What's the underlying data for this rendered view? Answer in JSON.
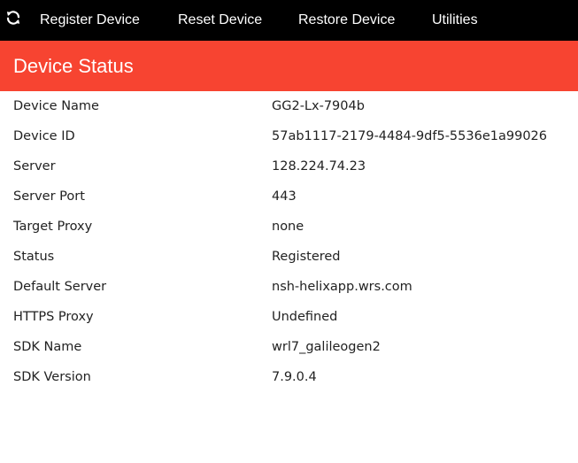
{
  "nav": {
    "refresh_icon": "refresh-icon",
    "items": [
      {
        "label": "Register Device"
      },
      {
        "label": "Reset Device"
      },
      {
        "label": "Restore Device"
      },
      {
        "label": "Utilities"
      }
    ]
  },
  "header": {
    "title": "Device Status",
    "color": "#f74431"
  },
  "status": {
    "rows": [
      {
        "label": "Device Name",
        "value": "GG2-Lx-7904b"
      },
      {
        "label": "Device ID",
        "value": "57ab1117-2179-4484-9df5-5536e1a99026"
      },
      {
        "label": "Server",
        "value": "128.224.74.23"
      },
      {
        "label": "Server Port",
        "value": "443"
      },
      {
        "label": "Target Proxy",
        "value": "none"
      },
      {
        "label": "Status",
        "value": "Registered"
      },
      {
        "label": "Default Server",
        "value": "nsh-helixapp.wrs.com"
      },
      {
        "label": "HTTPS Proxy",
        "value": "Undefined"
      },
      {
        "label": "SDK Name",
        "value": "wrl7_galileogen2"
      },
      {
        "label": "SDK Version",
        "value": "7.9.0.4"
      }
    ]
  }
}
